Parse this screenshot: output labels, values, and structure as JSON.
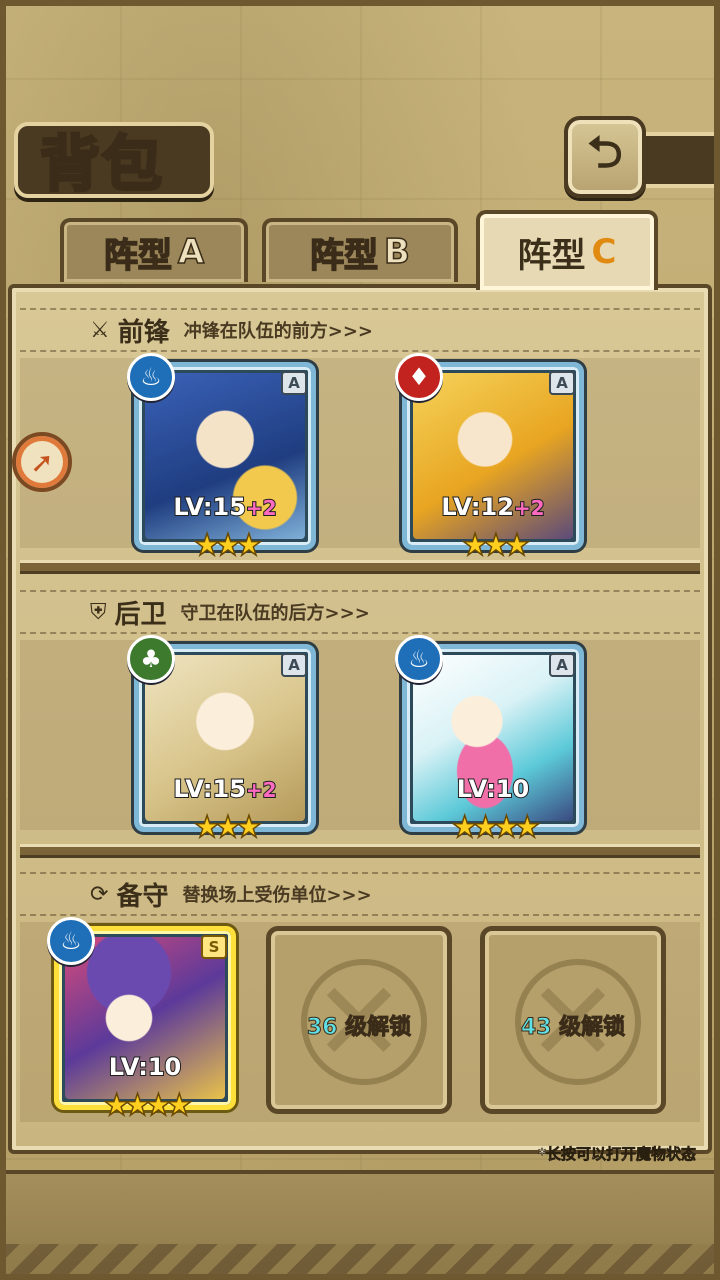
{
  "header": {
    "title": "背包",
    "back_icon": "back-arrow-icon"
  },
  "tabs": [
    {
      "label": "阵型",
      "suffix": "A",
      "active": false
    },
    {
      "label": "阵型",
      "suffix": "B",
      "active": false
    },
    {
      "label": "阵型",
      "suffix": "C",
      "active": true
    }
  ],
  "sections": {
    "front": {
      "title": "前锋",
      "desc": "冲锋在队伍的前方>>>",
      "icon": "sword-icon"
    },
    "back": {
      "title": "后卫",
      "desc": "守卫在队伍的后方>>>",
      "icon": "shield-icon"
    },
    "reserve": {
      "title": "备守",
      "desc": "替换场上受伤单位>>>",
      "icon": "swap-icon"
    }
  },
  "cards": [
    {
      "element": "water",
      "element_glyph": "♨",
      "rank": "A",
      "level": "LV:15",
      "plus": "+2",
      "stars": "★★★",
      "star_count": 3
    },
    {
      "element": "fire",
      "element_glyph": "♦",
      "rank": "A",
      "level": "LV:12",
      "plus": "+2",
      "stars": "★★★",
      "star_count": 3
    },
    {
      "element": "wood",
      "element_glyph": "♣",
      "rank": "A",
      "level": "LV:15",
      "plus": "+2",
      "stars": "★★★",
      "star_count": 3
    },
    {
      "element": "water",
      "element_glyph": "♨",
      "rank": "A",
      "level": "LV:10",
      "plus": "",
      "stars": "★★★★",
      "star_count": 4
    },
    {
      "element": "water",
      "element_glyph": "♨",
      "rank": "S",
      "level": "LV:10",
      "plus": "",
      "stars": "★★★★",
      "star_count": 4
    }
  ],
  "locked_slots": [
    {
      "level": "36",
      "label": "级解锁"
    },
    {
      "level": "43",
      "label": "级解锁"
    }
  ],
  "hint": "*长按可以打开魔物状态",
  "colors": {
    "accent": "#e08a12",
    "water": "#1f6fb8",
    "fire": "#c2231e",
    "wood": "#3d7a2e",
    "card_frame": "#7fb7d6",
    "card_frame_s": "#ffe03a"
  }
}
